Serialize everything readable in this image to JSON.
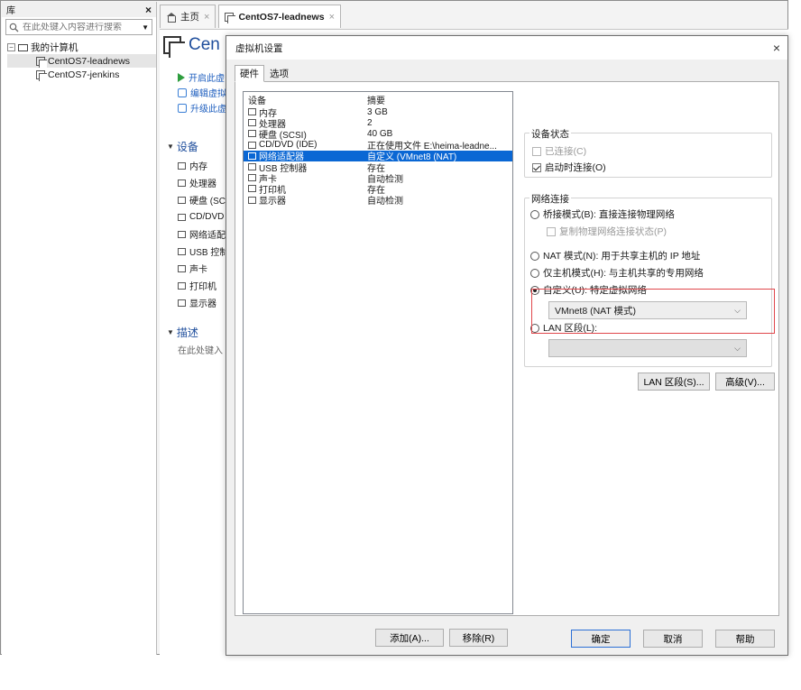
{
  "library": {
    "title": "库",
    "close": "×",
    "search_placeholder": "在此处键入内容进行搜索",
    "dropdown": "▼",
    "tree": {
      "root_label": "我的计算机",
      "root_expander": "−",
      "children": [
        "CentOS7-leadnews",
        "CentOS7-jenkins"
      ]
    }
  },
  "tabs": {
    "home": "主页",
    "vm": "CentOS7-leadnews",
    "close": "×"
  },
  "summary": {
    "title": "Cen",
    "actions": [
      "开启此虚",
      "编辑虚拟",
      "升级此虚"
    ],
    "devices_heading": "设备",
    "devices": [
      "内存",
      "处理器",
      "硬盘 (SC",
      "CD/DVD",
      "网络适配",
      "USB 控制",
      "声卡",
      "打印机",
      "显示器"
    ],
    "description_heading": "描述",
    "description_hint": "在此处键入"
  },
  "dialog": {
    "title": "虚拟机设置",
    "close": "×",
    "tabs": [
      "硬件",
      "选项"
    ],
    "table": {
      "col_device": "设备",
      "col_summary": "摘要",
      "rows": [
        {
          "device": "内存",
          "summary": "3 GB",
          "icon": "memory-icon"
        },
        {
          "device": "处理器",
          "summary": "2",
          "icon": "processor-icon"
        },
        {
          "device": "硬盘 (SCSI)",
          "summary": "40 GB",
          "icon": "hard-disk-icon"
        },
        {
          "device": "CD/DVD (IDE)",
          "summary": "正在使用文件 E:\\heima-leadne...",
          "icon": "cd-dvd-icon"
        },
        {
          "device": "网络适配器",
          "summary": "自定义 (VMnet8 (NAT)",
          "icon": "network-adapter-icon",
          "selected": true
        },
        {
          "device": "USB 控制器",
          "summary": "存在",
          "icon": "usb-icon"
        },
        {
          "device": "声卡",
          "summary": "自动检测",
          "icon": "sound-card-icon"
        },
        {
          "device": "打印机",
          "summary": "存在",
          "icon": "printer-icon"
        },
        {
          "device": "显示器",
          "summary": "自动检测",
          "icon": "display-icon"
        }
      ]
    },
    "add_button": "添加(A)...",
    "remove_button": "移除(R)",
    "device_status": {
      "title": "设备状态",
      "connected": "已连接(C)",
      "connect_on_power": "启动时连接(O)"
    },
    "network": {
      "title": "网络连接",
      "bridged": "桥接模式(B): 直接连接物理网络",
      "replicate": "复制物理网络连接状态(P)",
      "nat": "NAT 模式(N): 用于共享主机的 IP 地址",
      "host_only": "仅主机模式(H): 与主机共享的专用网络",
      "custom": "自定义(U): 特定虚拟网络",
      "custom_value": "VMnet8 (NAT 模式)",
      "lan_segment": "LAN 区段(L):",
      "lan_value": ""
    },
    "lan_segments_button": "LAN 区段(S)...",
    "advanced_button": "高级(V)...",
    "ok_button": "确定",
    "cancel_button": "取消",
    "help_button": "帮助"
  },
  "colors": {
    "selection": "#0a67d4",
    "highlight_box": "#e0464b",
    "link": "#1f5fbf"
  }
}
